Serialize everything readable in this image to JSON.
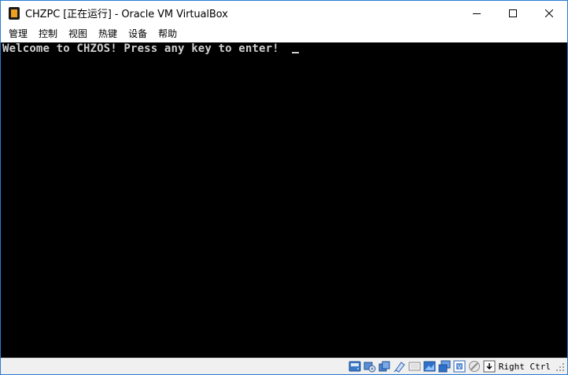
{
  "window": {
    "title": "CHZPC [正在运行] - Oracle VM VirtualBox"
  },
  "menu": {
    "items": [
      {
        "label": "管理"
      },
      {
        "label": "控制"
      },
      {
        "label": "视图"
      },
      {
        "label": "热键"
      },
      {
        "label": "设备"
      },
      {
        "label": "帮助"
      }
    ]
  },
  "vm_console": {
    "text": "Welcome to CHZOS! Press any key to enter!"
  },
  "statusbar": {
    "icons": [
      "hard-disk-icon",
      "optical-drive-icon",
      "audio-icon",
      "network-icon",
      "usb-icon",
      "shared-folders-icon",
      "display-icon",
      "video-capture-icon",
      "virtualization-icon",
      "mouse-integration-icon",
      "keyboard-capture-icon"
    ],
    "host_key": "Right Ctrl"
  },
  "colors": {
    "screen_bg": "#000000",
    "console_text": "#d0d0d0",
    "window_border": "#2b7bd3"
  }
}
